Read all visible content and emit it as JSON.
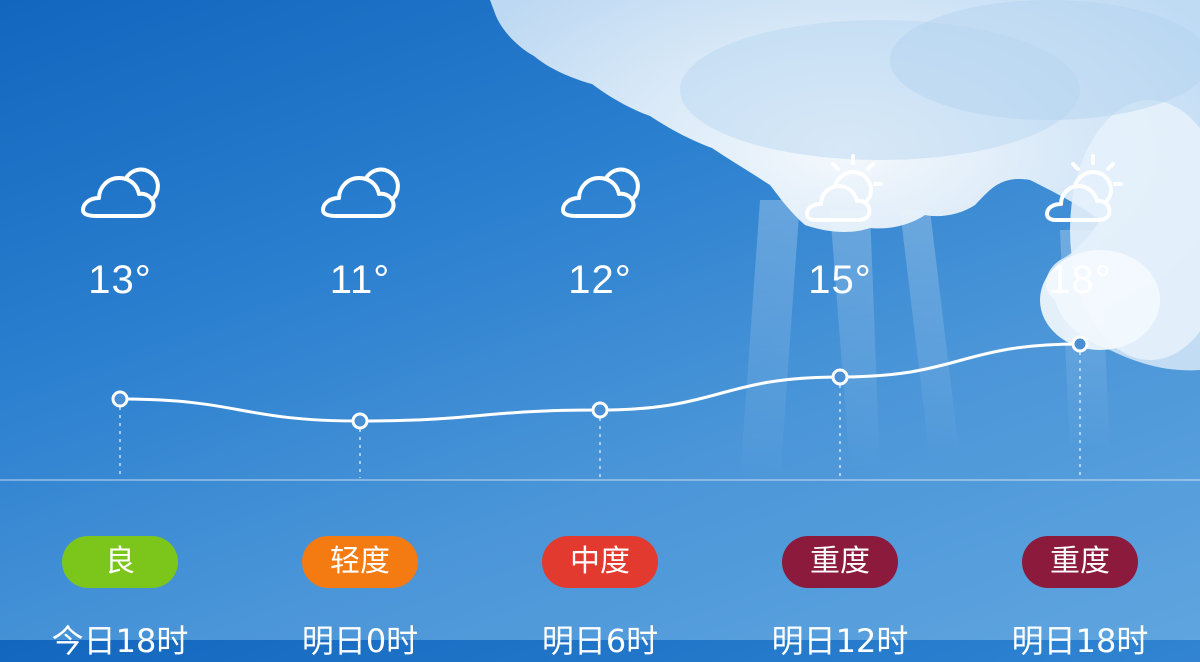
{
  "forecast": [
    {
      "icon": "cloudy-icon",
      "temp": "13°",
      "temp_value": 13,
      "aqi": "良",
      "aqi_color": "#7cc61c",
      "time": "今日18时"
    },
    {
      "icon": "cloudy-icon",
      "temp": "11°",
      "temp_value": 11,
      "aqi": "轻度",
      "aqi_color": "#f47a12",
      "time": "明日0时"
    },
    {
      "icon": "cloudy-icon",
      "temp": "12°",
      "temp_value": 12,
      "aqi": "中度",
      "aqi_color": "#e23a2e",
      "time": "明日6时"
    },
    {
      "icon": "partly-sunny-icon",
      "temp": "15°",
      "temp_value": 15,
      "aqi": "重度",
      "aqi_color": "#8b1a3c",
      "time": "明日12时"
    },
    {
      "icon": "partly-sunny-icon",
      "temp": "18°",
      "temp_value": 18,
      "aqi": "重度",
      "aqi_color": "#8b1a3c",
      "time": "明日18时"
    }
  ],
  "colors": {
    "sky_top": "#1266be",
    "sky_bottom": "#5fa5df",
    "line": "#ffffff"
  }
}
